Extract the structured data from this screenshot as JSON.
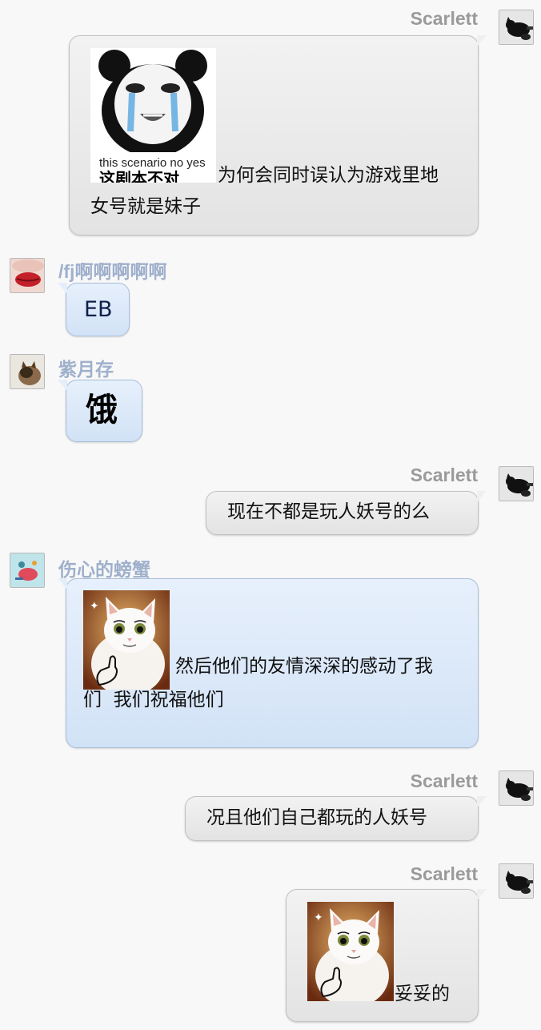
{
  "messages": [
    {
      "sender": "Scarlett",
      "side": "right",
      "sticker": {
        "kind": "panda-meme",
        "caption_small": "this scenario no yes",
        "caption_big": "这剧本不对"
      },
      "lines": [
        "为何会同时误认为游戏里地",
        "女号就是妹子"
      ]
    },
    {
      "sender": "/fj啊啊啊啊啊",
      "side": "left",
      "text": "EB"
    },
    {
      "sender": "紫月存",
      "side": "left",
      "text": "饿"
    },
    {
      "sender": "Scarlett",
      "side": "right",
      "text": "现在不都是玩人妖号的么"
    },
    {
      "sender": "伤心的螃蟹",
      "side": "left",
      "sticker": {
        "kind": "cat-thumbs-up"
      },
      "lines": [
        "然后他们的友情深深的感动了我",
        "们  我们祝福他们"
      ]
    },
    {
      "sender": "Scarlett",
      "side": "right",
      "text": "况且他们自己都玩的人妖号"
    },
    {
      "sender": "Scarlett",
      "side": "right",
      "sticker": {
        "kind": "cat-thumbs-up"
      },
      "text": "妥妥的"
    }
  ],
  "colors": {
    "right_name": "#9a9a9a",
    "left_name": "#9fb0cc",
    "blue_bubble": "#d8e6f8",
    "gray_bubble": "#e8e8e8"
  }
}
